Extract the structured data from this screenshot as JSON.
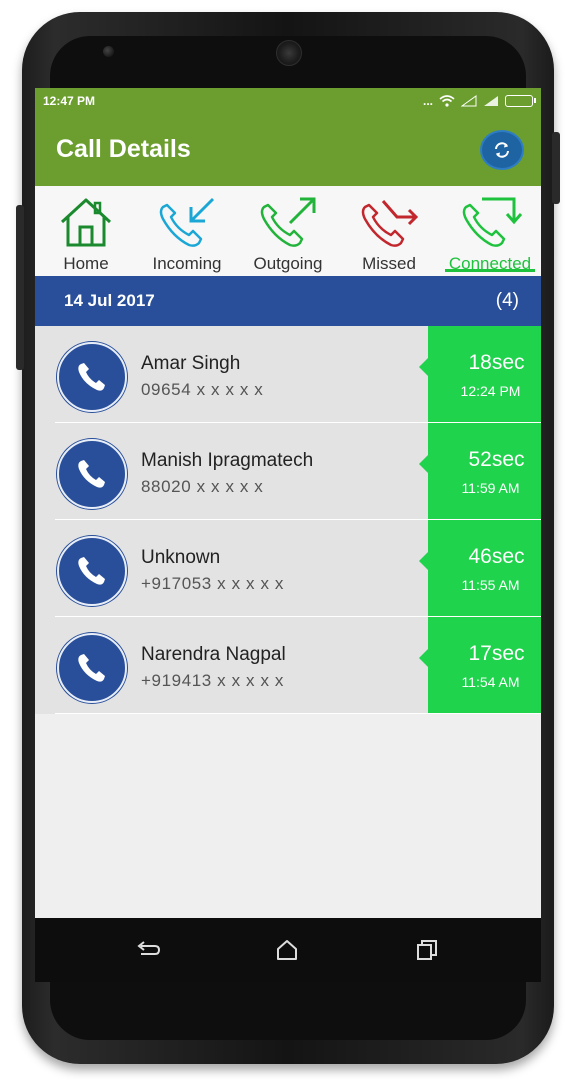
{
  "status_bar": {
    "time": "12:47 PM",
    "indicators": "..."
  },
  "app_bar": {
    "title": "Call Details",
    "refresh_icon": "refresh-icon"
  },
  "tabs": [
    {
      "label": "Home",
      "icon": "home-icon",
      "color": "#1b8a2e",
      "active": false
    },
    {
      "label": "Incoming",
      "icon": "incoming-call-icon",
      "color": "#1ba7d6",
      "active": false
    },
    {
      "label": "Outgoing",
      "icon": "outgoing-call-icon",
      "color": "#22b33a",
      "active": false
    },
    {
      "label": "Missed",
      "icon": "missed-call-icon",
      "color": "#c1272d",
      "active": false
    },
    {
      "label": "Connected",
      "icon": "connected-call-icon",
      "color": "#1ec23d",
      "active": true
    }
  ],
  "date_header": {
    "date": "14 Jul 2017",
    "count": "(4)"
  },
  "calls": [
    {
      "name": "Amar Singh",
      "number": "09654 x x x x x",
      "duration": "18sec",
      "time": "12:24 PM"
    },
    {
      "name": "Manish Ipragmatech",
      "number": "88020 x x x x x",
      "duration": "52sec",
      "time": "11:59 AM"
    },
    {
      "name": "Unknown",
      "number": "+917053 x x x x x",
      "duration": "46sec",
      "time": "11:55 AM"
    },
    {
      "name": "Narendra Nagpal",
      "number": "+919413 x x x x x",
      "duration": "17sec",
      "time": "11:54 AM"
    }
  ],
  "colors": {
    "app_bar": "#6b9e2e",
    "date_bar": "#2a4f9a",
    "duration_block": "#1fd34d",
    "avatar": "#2a4f9a"
  },
  "nav_bar": {
    "back": "back-icon",
    "home": "home-nav-icon",
    "recents": "recents-icon"
  }
}
